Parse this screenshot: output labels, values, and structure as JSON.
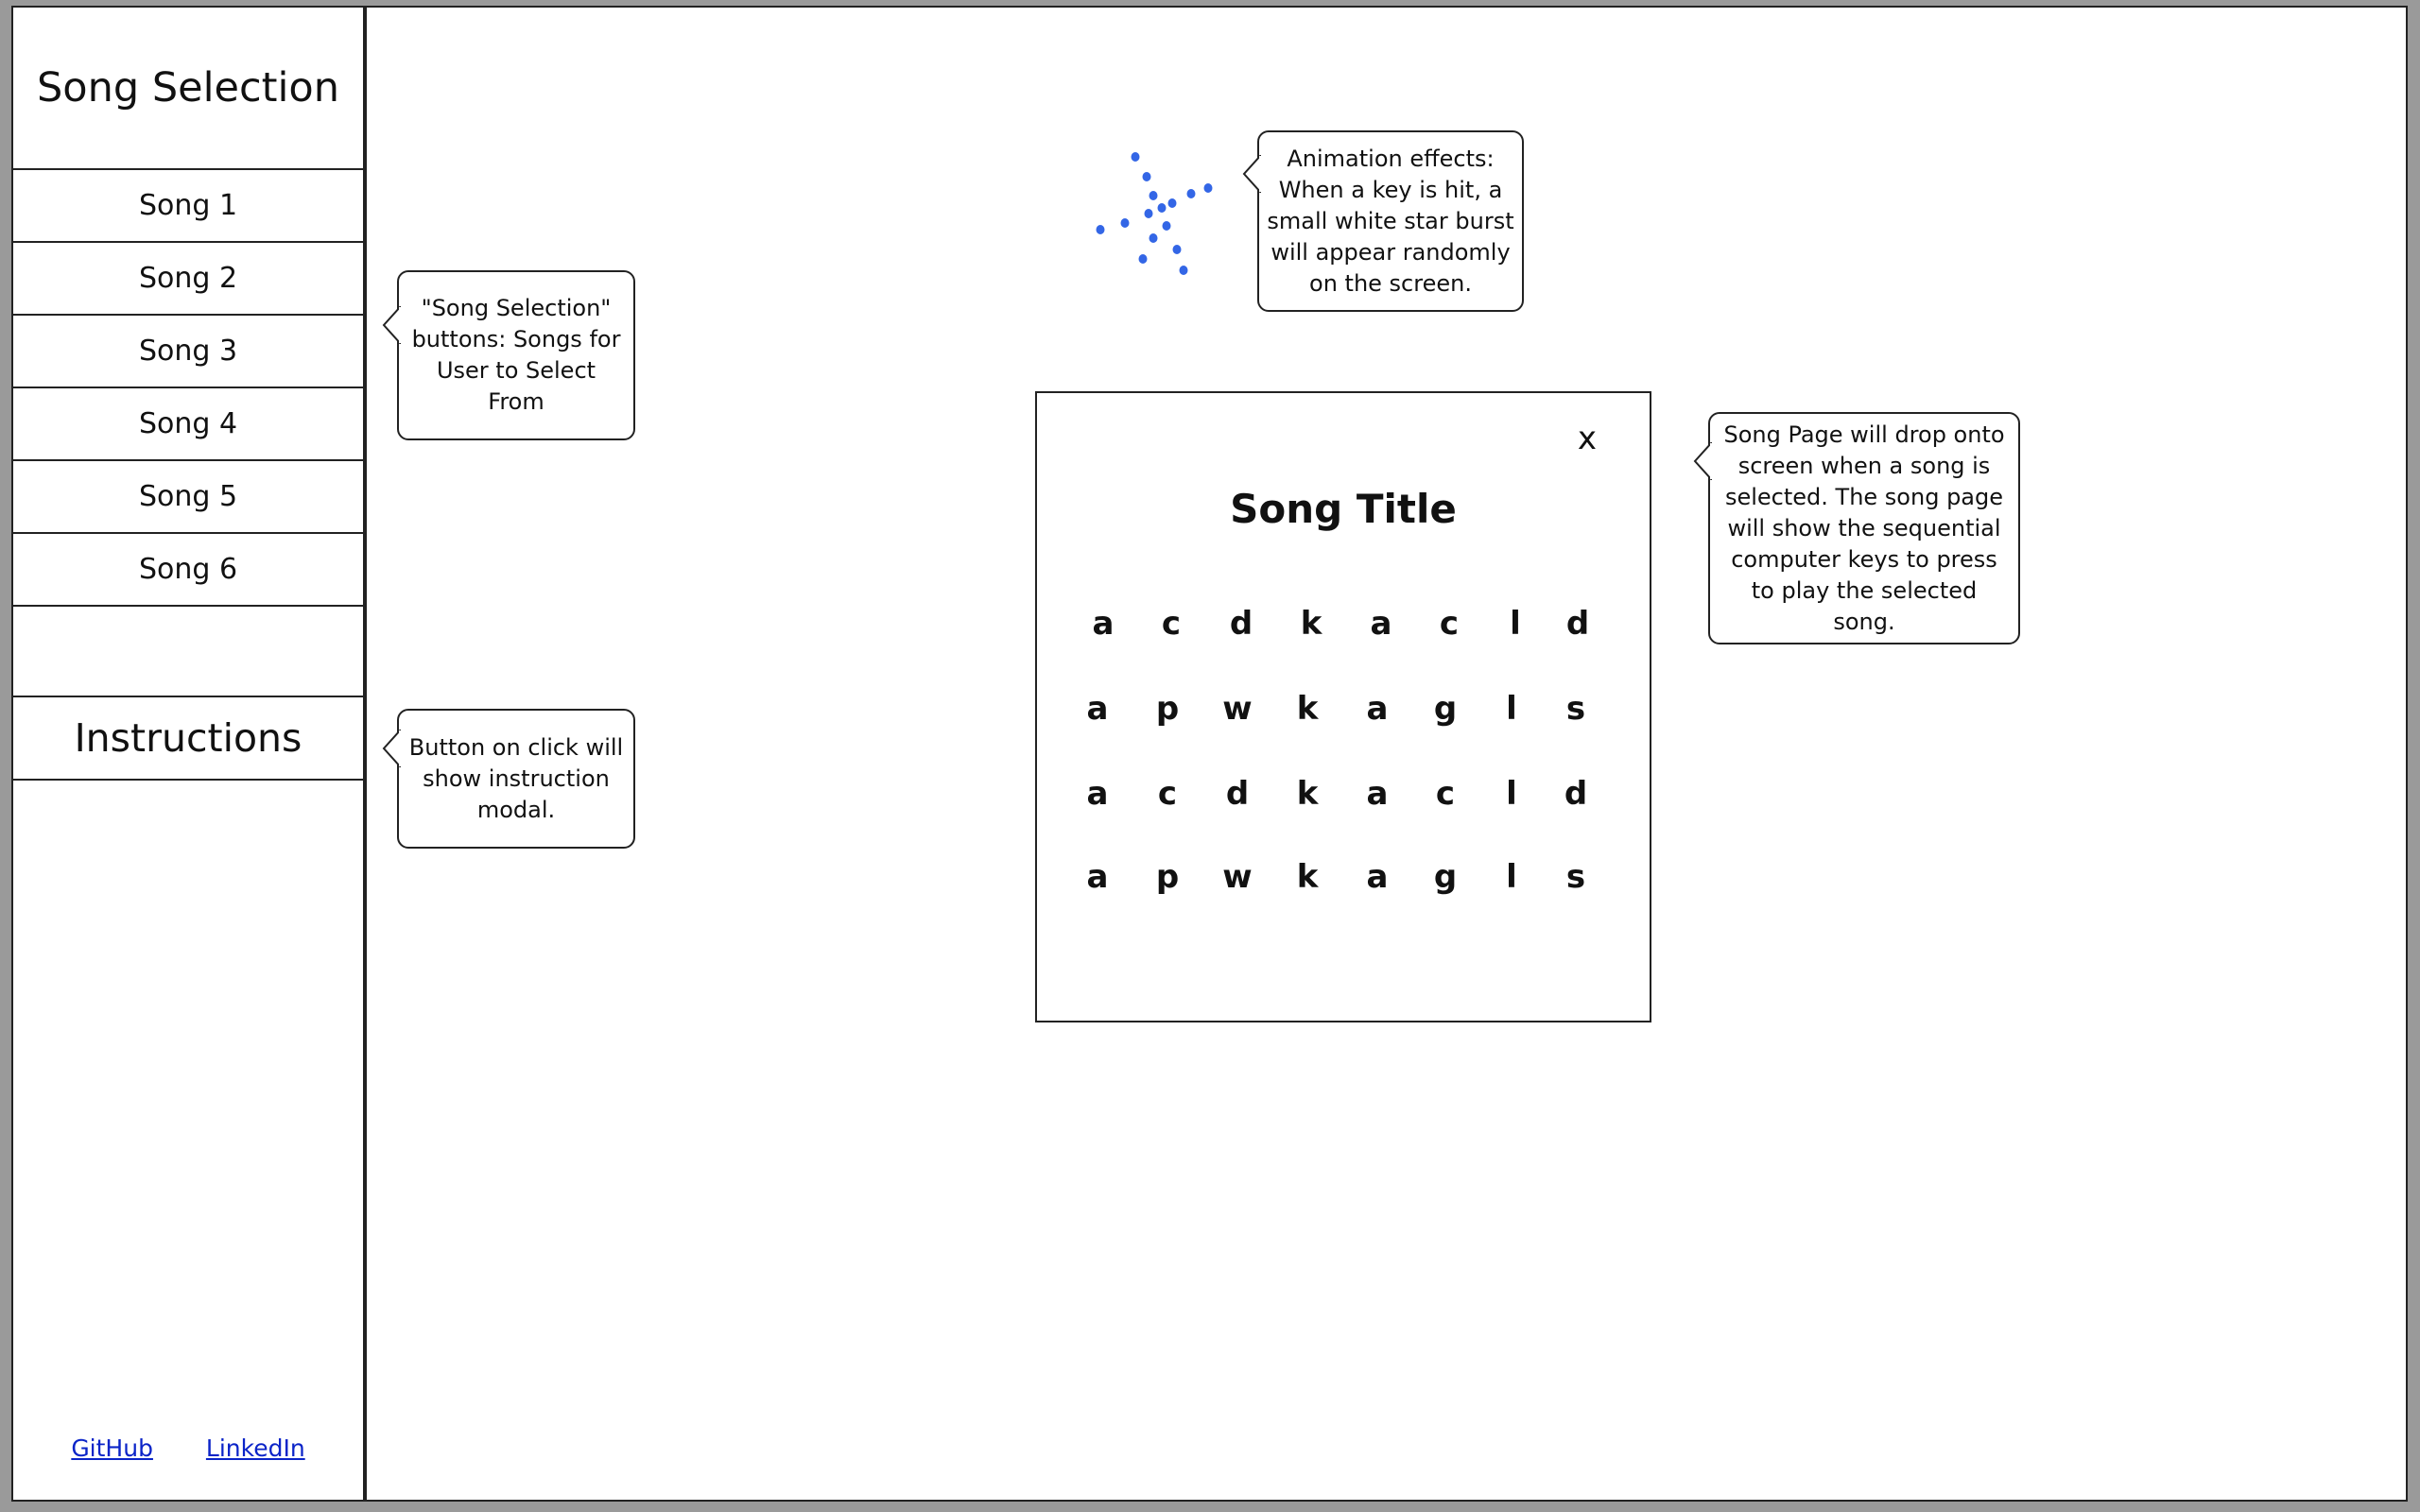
{
  "sidebar": {
    "title": "Song Selection",
    "songs": [
      "Song 1",
      "Song 2",
      "Song 3",
      "Song 4",
      "Song 5",
      "Song 6"
    ],
    "instructions_label": "Instructions",
    "links": {
      "github": "GitHub",
      "linkedin": "LinkedIn"
    }
  },
  "callouts": {
    "song_selection": "\"Song Selection\" buttons: Songs for User to Select From",
    "instructions": "Button on click will show instruction modal.",
    "animation": "Animation effects: When a key is hit, a small white star burst will appear randomly on the screen.",
    "song_page": "Song Page will drop onto screen when a song is selected. The song page will show the sequential computer keys to press to play the selected song."
  },
  "song_page": {
    "close_label": "x",
    "title": "Song Title",
    "key_rows": [
      [
        "a",
        "c",
        "d",
        "k",
        "a",
        "c",
        "l",
        "d"
      ],
      [
        "a",
        "p",
        "w",
        "k",
        "a",
        "g",
        "l",
        "s"
      ],
      [
        "a",
        "c",
        "d",
        "k",
        "a",
        "c",
        "l",
        "d"
      ],
      [
        "a",
        "p",
        "w",
        "k",
        "a",
        "g",
        "l",
        "s"
      ]
    ]
  },
  "colors": {
    "burst_dot": "#3366e6",
    "link": "#0b24c8"
  }
}
